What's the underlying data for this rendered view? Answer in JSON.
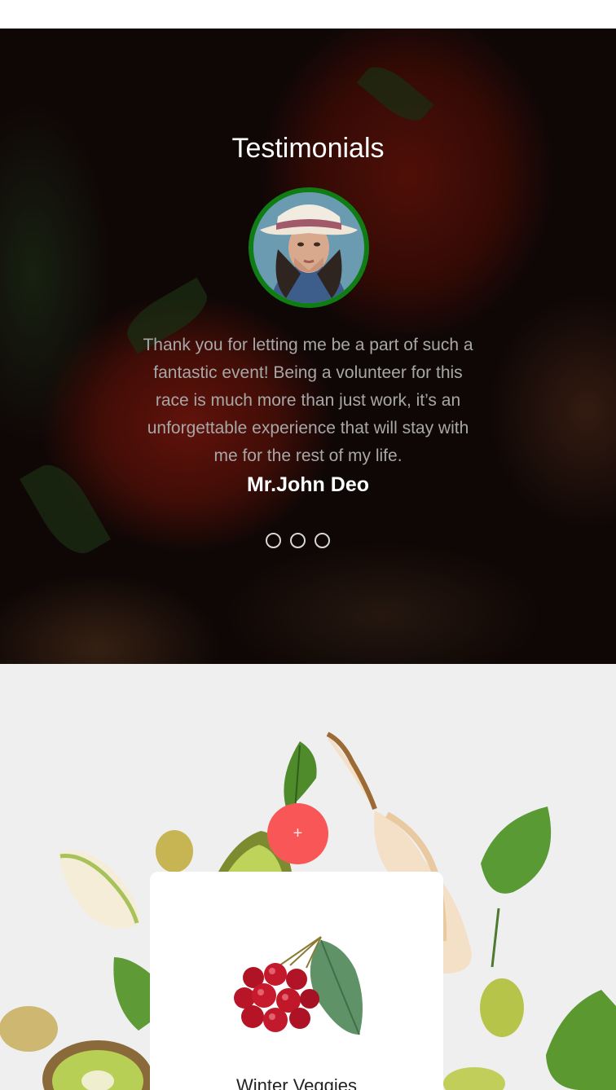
{
  "testimonials": {
    "title": "Testimonials",
    "quote": "Thank you for letting me be a part of such a fantastic event! Being a volunteer for this race is much more than just work, it’s an unforgettable experience that will stay with me for the rest of my life.",
    "author": "Mr.John Deo",
    "avatar_icon": "woman-portrait-avatar",
    "avatar_ring_color": "#0f7d14",
    "dots_count": 3
  },
  "product": {
    "add_icon": "plus-icon",
    "add_label": "+",
    "add_button_color": "#f95757",
    "title": "Winter Veggies",
    "image_icon": "cherries-icon"
  }
}
